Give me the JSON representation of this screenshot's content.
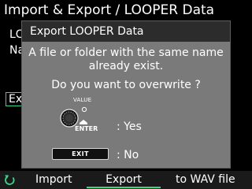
{
  "screen_title": "Import & Export / LOOPER Data",
  "background_fragments": {
    "line1": "LC",
    "line2": "Na",
    "selected_button": "Ex"
  },
  "dialog": {
    "title": "Export LOOPER Data",
    "message_line1": "A file or folder with the same name",
    "message_line2": "already exist.",
    "question": "Do you want to overwrite ?",
    "value_knob_label": "VALUE",
    "enter_label": "ENTER",
    "yes_label": ": Yes",
    "exit_key_label": "EXIT",
    "no_label": ": No"
  },
  "tabs": {
    "icon": "back-arrow-icon",
    "items": [
      "Import",
      "Export",
      "to WAV file"
    ],
    "selected": "Export"
  },
  "colors": {
    "accent": "#3ad38a",
    "dialog_bg": "#7a7a7a",
    "dialog_header": "#2c2c2c"
  }
}
